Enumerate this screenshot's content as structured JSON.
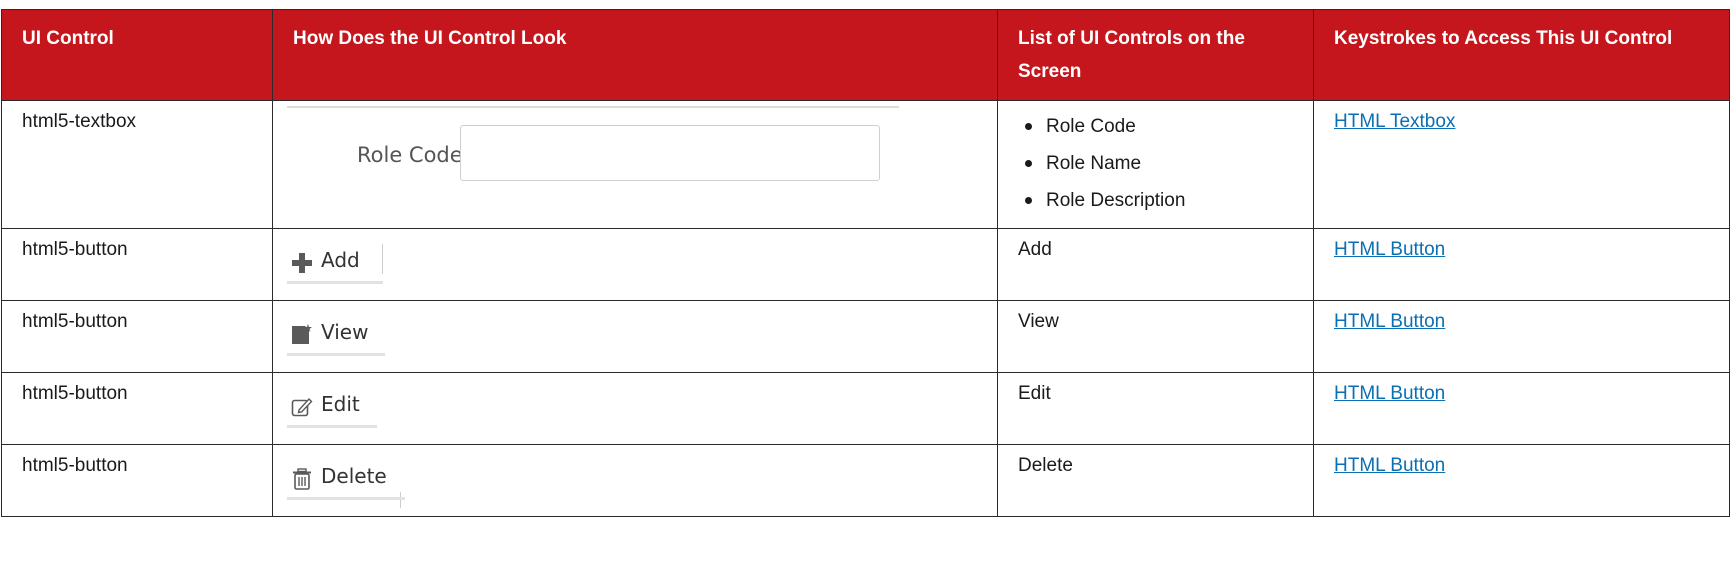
{
  "table": {
    "headers": [
      "UI Control",
      "How Does the UI Control Look",
      "List of UI Controls on the Screen",
      "Keystrokes to Access This UI Control"
    ],
    "rows": [
      {
        "control": "html5-textbox",
        "preview": {
          "label": "Role Code"
        },
        "controls_list": [
          "Role Code",
          "Role Name",
          "Role Description"
        ],
        "link": "HTML Textbox"
      },
      {
        "control": "html5-button",
        "preview": {
          "label": "Add",
          "icon": "plus-icon"
        },
        "controls_text": "Add",
        "link": "HTML Button"
      },
      {
        "control": "html5-button",
        "preview": {
          "label": "View",
          "icon": "view-document-icon"
        },
        "controls_text": "View",
        "link": "HTML Button"
      },
      {
        "control": "html5-button",
        "preview": {
          "label": "Edit",
          "icon": "edit-pencil-icon"
        },
        "controls_text": "Edit",
        "link": "HTML Button"
      },
      {
        "control": "html5-button",
        "preview": {
          "label": "Delete",
          "icon": "trash-icon"
        },
        "controls_text": "Delete",
        "link": "HTML Button"
      }
    ]
  },
  "colors": {
    "header_bg": "#c4161c",
    "header_text": "#ffffff",
    "link": "#0a6fb3",
    "border": "#2b2b2b"
  }
}
